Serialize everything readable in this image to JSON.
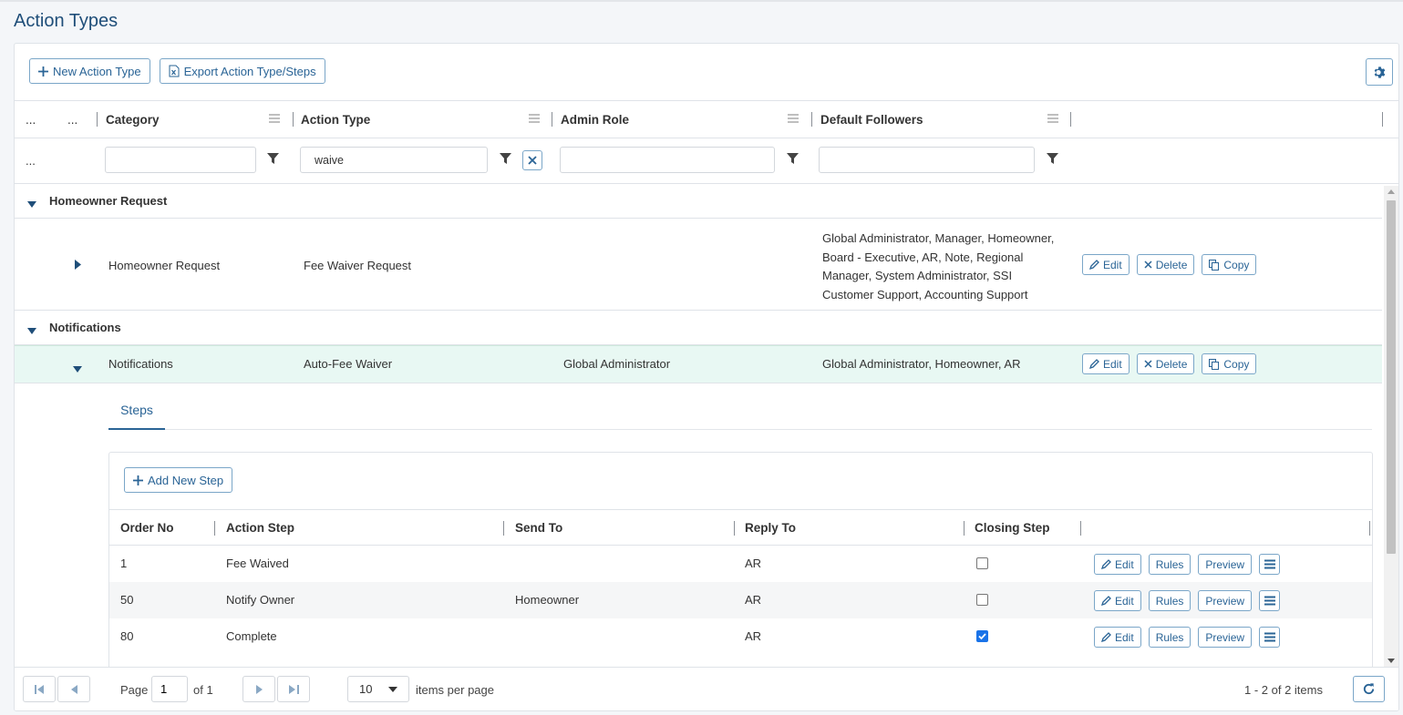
{
  "page": {
    "title": "Action Types"
  },
  "toolbar": {
    "new_label": "New Action Type",
    "export_label": "Export Action Type/Steps"
  },
  "grid": {
    "columns": {
      "c1": "...",
      "c2": "...",
      "category": "Category",
      "action_type": "Action Type",
      "admin_role": "Admin Role",
      "default_followers": "Default Followers"
    },
    "filters": {
      "ellipsis": "...",
      "category": "",
      "action_type": "waive",
      "admin_role": "",
      "default_followers": ""
    },
    "groups": [
      {
        "label": "Homeowner Request",
        "rows": [
          {
            "category": "Homeowner Request",
            "action_type": "Fee Waiver Request",
            "admin_role": "",
            "followers": [
              "Global Administrator, Manager, Homeowner,",
              "Board - Executive, AR, Note, Regional",
              "Manager, System Administrator, SSI",
              "Customer Support, Accounting Support"
            ]
          }
        ]
      },
      {
        "label": "Notifications",
        "rows": [
          {
            "category": "Notifications",
            "action_type": "Auto-Fee Waiver",
            "admin_role": "Global Administrator",
            "followers": [
              "Global Administrator, Homeowner, AR"
            ]
          }
        ]
      }
    ],
    "row_buttons": {
      "edit": "Edit",
      "delete": "Delete",
      "copy": "Copy"
    }
  },
  "detail": {
    "tab": "Steps",
    "add_step_label": "Add New Step",
    "columns": {
      "order": "Order No",
      "step": "Action Step",
      "send_to": "Send To",
      "reply_to": "Reply To",
      "closing": "Closing Step"
    },
    "steps": [
      {
        "order": "1",
        "step": "Fee Waived",
        "send_to": "",
        "reply_to": "AR",
        "closing": false
      },
      {
        "order": "50",
        "step": "Notify Owner",
        "send_to": "Homeowner",
        "reply_to": "AR",
        "closing": false
      },
      {
        "order": "80",
        "step": "Complete",
        "send_to": "",
        "reply_to": "AR",
        "closing": true
      }
    ],
    "buttons": {
      "edit": "Edit",
      "rules": "Rules",
      "preview": "Preview"
    }
  },
  "pager": {
    "page_label": "Page",
    "page": "1",
    "of_label": "of 1",
    "page_size": "10",
    "per_page_label": "items per page",
    "summary": "1 - 2 of 2 items"
  },
  "colors": {
    "accent": "#2a6496",
    "title": "#1f4e79",
    "selected_row": "#e8f8f3"
  },
  "icons": [
    "plus-icon",
    "excel-icon",
    "gear-icon",
    "column-menu-icon",
    "filter-icon",
    "clear-icon",
    "caret-down-icon",
    "caret-right-icon",
    "pencil-icon",
    "x-icon",
    "copy-icon",
    "hamburger-icon",
    "first-page-icon",
    "prev-page-icon",
    "next-page-icon",
    "last-page-icon",
    "refresh-icon"
  ]
}
